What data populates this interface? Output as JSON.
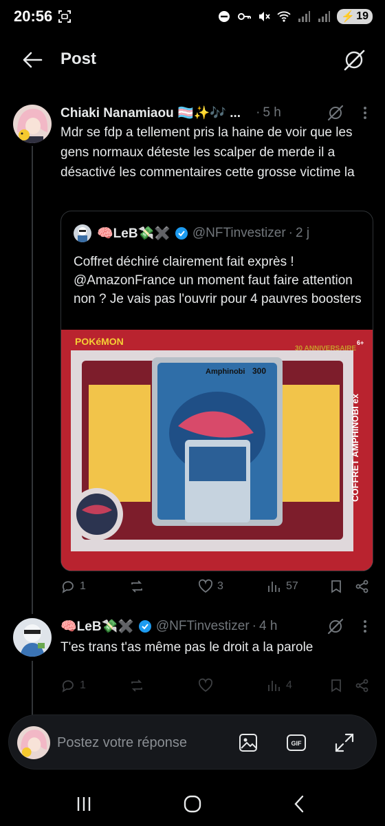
{
  "status_bar": {
    "time": "20:56",
    "battery": "19"
  },
  "header": {
    "title": "Post"
  },
  "post": {
    "author_name": "Chiaki Nanamiaou 🏳️‍⚧️✨🎶 ...",
    "time": "5 h",
    "text": "Mdr se fdp a tellement pris la haine de voir que les gens normaux déteste les scalper de merde il a désactivé les commentaires cette grosse victime la",
    "quote": {
      "author_name": "🧠LeB💸✖️",
      "handle": "@NFTinvestizer",
      "time": "2 j",
      "text": "Coffret déchiré clairement fait exprès ! @AmazonFrance un moment faut faire attention non ? Je vais pas l'ouvrir pour 4 pauvres boosters",
      "image": {
        "product_title": "COFFRET AMPHINOBI ex",
        "card_name": "Amphinobi",
        "card_hp": "300",
        "anniversary": "30 ANNIVERSAIRE",
        "age": "6+",
        "brand": "POKéMON"
      }
    },
    "stats": {
      "replies": "1",
      "reposts": "",
      "likes": "3",
      "views": "57"
    }
  },
  "reply": {
    "author_name": "🧠LeB💸✖️",
    "handle": "@NFTinvestizer",
    "time": "4 h",
    "text": "T'es trans t'as même pas le droit a la parole",
    "stats": {
      "replies": "1",
      "reposts": "",
      "likes": "",
      "views": "4"
    }
  },
  "composer": {
    "placeholder": "Postez votre réponse"
  },
  "colors": {
    "background": "#000000",
    "text": "#e7e9ea",
    "muted": "#71767b",
    "verified": "#1d9bf0",
    "border": "#2f3336"
  }
}
